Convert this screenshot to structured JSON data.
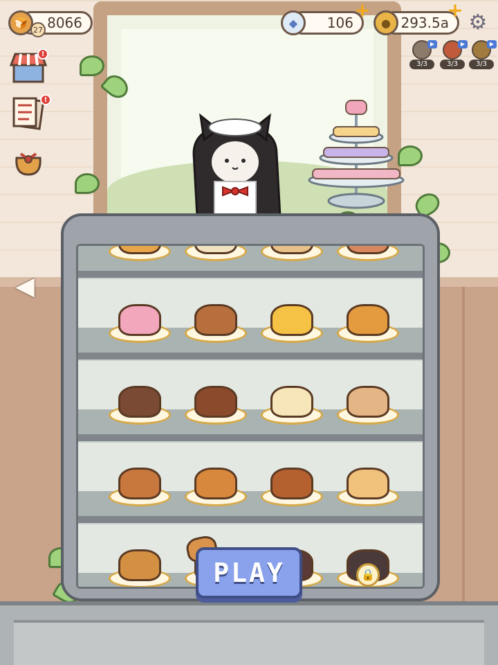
{
  "hud": {
    "bread_count": "8066",
    "player_level": "27",
    "diamonds": "106",
    "coins": "293.5a"
  },
  "boosts": [
    {
      "icon": "cat-boost-icon",
      "count": "3/3"
    },
    {
      "icon": "fire-boost-icon",
      "count": "3/3"
    },
    {
      "icon": "bell-boost-icon",
      "count": "3/3"
    }
  ],
  "side_menu": [
    {
      "name": "shop-stall-icon",
      "alert": "!"
    },
    {
      "name": "quest-list-icon",
      "alert": "!"
    },
    {
      "name": "gift-bag-icon",
      "alert": ""
    }
  ],
  "play_button": {
    "label": "PLAY"
  },
  "shelves": [
    {
      "row": "top-partial",
      "items": [
        {
          "name": "honey-toast",
          "color": "#e8a64a"
        },
        {
          "name": "cream-bun",
          "color": "#f1e2c0"
        },
        {
          "name": "round-bread",
          "color": "#e7c08a"
        },
        {
          "name": "strawberry-tart",
          "color": "#d9875e"
        }
      ]
    },
    {
      "row": "1",
      "items": [
        {
          "name": "ice-cream-cake",
          "color": "#f3a7bd"
        },
        {
          "name": "scone-sandwich",
          "color": "#b7703d"
        },
        {
          "name": "cheese-wedge",
          "color": "#f6c245"
        },
        {
          "name": "egg-tart",
          "color": "#e49a3f"
        }
      ]
    },
    {
      "row": "2",
      "items": [
        {
          "name": "country-loaf",
          "color": "#7a4a34"
        },
        {
          "name": "canele",
          "color": "#8c4a2d"
        },
        {
          "name": "souffle-pancake",
          "color": "#f7e6b9"
        },
        {
          "name": "bear-macaron",
          "color": "#e4b686"
        }
      ]
    },
    {
      "row": "3",
      "items": [
        {
          "name": "sausage-roll",
          "color": "#c8773d"
        },
        {
          "name": "muffin",
          "color": "#d8883c"
        },
        {
          "name": "cinnamon-roll",
          "color": "#b5602f"
        },
        {
          "name": "milk-bread-loaf",
          "color": "#f0c27c"
        }
      ]
    },
    {
      "row": "4",
      "items": [
        {
          "name": "bun",
          "color": "#d39042"
        },
        {
          "name": "hidden-item",
          "color": "#5a3a36"
        },
        {
          "name": "hidden-item",
          "color": "#5a3a36"
        },
        {
          "name": "locked-gravestone-cake",
          "color": "#4a3a3a",
          "locked": true
        }
      ]
    }
  ]
}
